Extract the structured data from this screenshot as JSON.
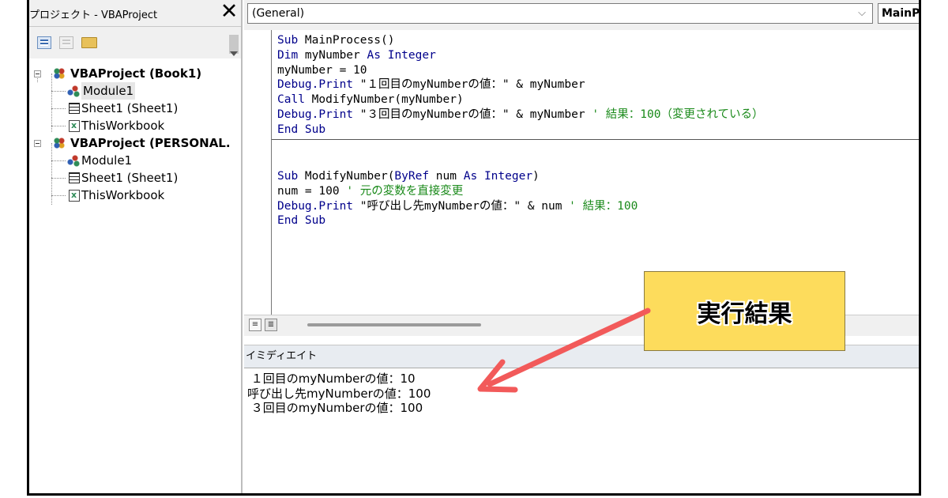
{
  "project_explorer": {
    "title": "プロジェクト - VBAProject",
    "close_icon": "close-x-icon",
    "tree": [
      {
        "label": "VBAProject (Book1)",
        "level": 0,
        "icon": "vbaproject-icon",
        "expanded": true
      },
      {
        "label": "Module1",
        "level": 1,
        "icon": "module-icon",
        "selected": true
      },
      {
        "label": "Sheet1 (Sheet1)",
        "level": 1,
        "icon": "sheet-icon"
      },
      {
        "label": "ThisWorkbook",
        "level": 1,
        "icon": "workbook-icon"
      },
      {
        "label": "VBAProject (PERSONAL.",
        "level": 0,
        "icon": "vbaproject-icon",
        "expanded": true
      },
      {
        "label": "Module1",
        "level": 1,
        "icon": "module-icon"
      },
      {
        "label": "Sheet1 (Sheet1)",
        "level": 1,
        "icon": "sheet-icon"
      },
      {
        "label": "ThisWorkbook",
        "level": 1,
        "icon": "workbook-icon"
      }
    ]
  },
  "code_window": {
    "object_combo": "(General)",
    "proc_combo": "MainP",
    "lines1": [
      "Sub MainProcess()",
      "Dim myNumber As Integer",
      "myNumber = 10",
      "Debug.Print \"１回目のmyNumberの値：\" & myNumber",
      "Call ModifyNumber(myNumber)",
      "Debug.Print \"３回目のmyNumberの値：\" & myNumber ' 結果：100（変更されている）",
      "End Sub"
    ],
    "lines2": [
      "Sub ModifyNumber(ByRef num As Integer)",
      "num = 100 ' 元の変数を直接変更",
      "Debug.Print \"呼び出し先myNumberの値：\" & num ' 結果：100",
      "End Sub"
    ]
  },
  "immediate": {
    "title": "イミディエイト",
    "output": [
      " １回目のmyNumberの値：10",
      "呼び出し先myNumberの値：100",
      " ３回目のmyNumberの値：100"
    ]
  },
  "callout": {
    "label": "実行結果"
  },
  "colors": {
    "keyword": "#00008b",
    "comment": "#1a8a1a",
    "callout_bg": "#fddc5c",
    "arrow": "#f25a5a"
  }
}
